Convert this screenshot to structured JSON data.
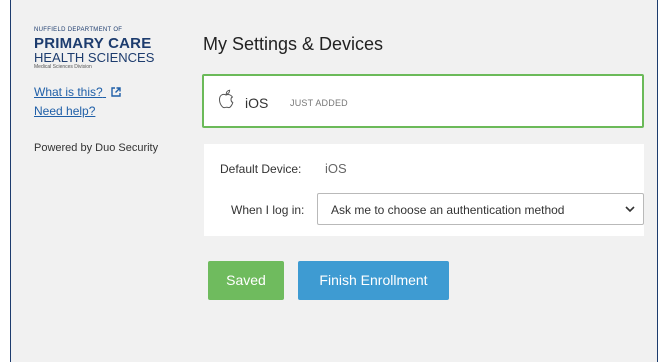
{
  "logo": {
    "line1": "NUFFIELD DEPARTMENT OF",
    "line2": "PRIMARY CARE",
    "line3": "HEALTH SCIENCES",
    "line4": "Medical Sciences Division"
  },
  "sidebar": {
    "what_is_this": "What is this?",
    "need_help": "Need help?",
    "powered_by": "Powered by Duo Security"
  },
  "main": {
    "title": "My Settings & Devices",
    "device": {
      "icon": "apple-icon",
      "name": "iOS",
      "badge": "JUST ADDED"
    },
    "settings": {
      "default_device_label": "Default Device:",
      "default_device_value": "iOS",
      "when_login_label": "When I log in:",
      "when_login_selected": "Ask me to choose an authentication method"
    },
    "buttons": {
      "saved": "Saved",
      "finish": "Finish Enrollment"
    }
  },
  "colors": {
    "device_border": "#6bba59",
    "saved_button": "#6fbb5e",
    "finish_button": "#3e9bd2",
    "link": "#1f5fa8",
    "frame_border": "#1d3c6e"
  }
}
